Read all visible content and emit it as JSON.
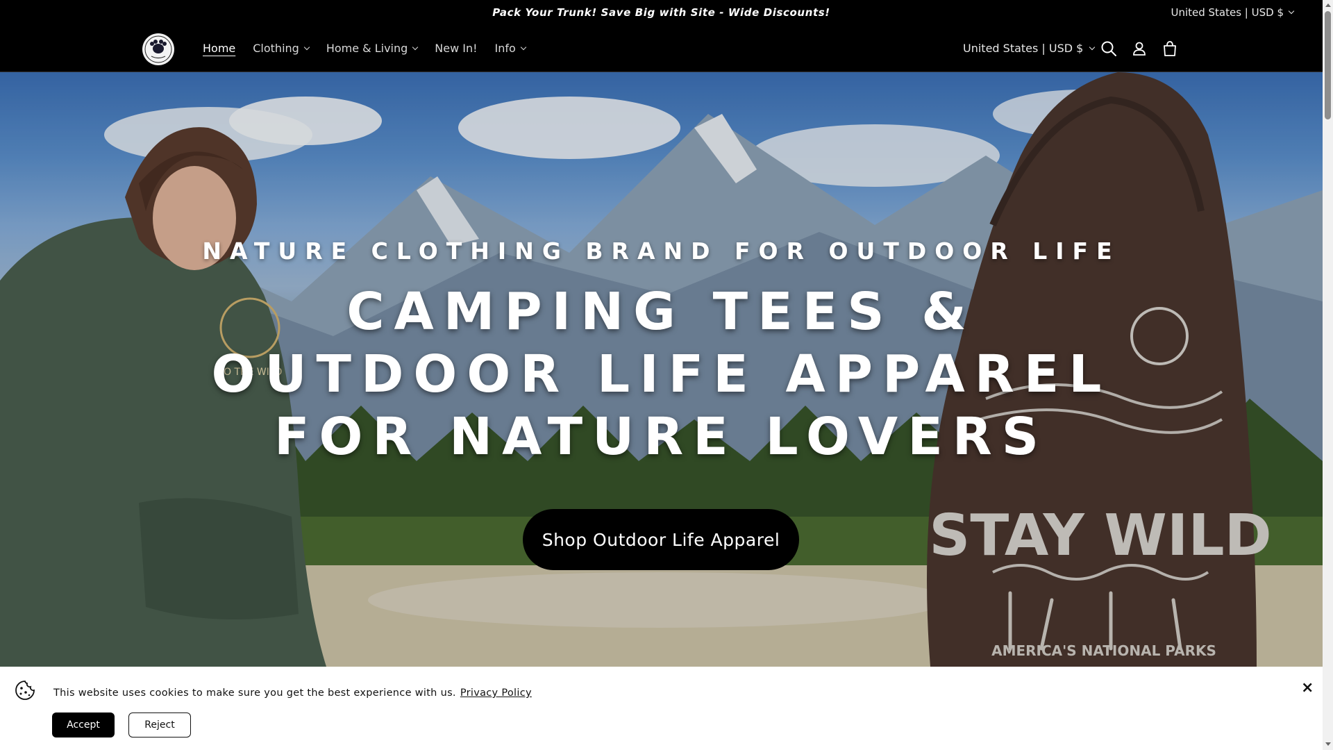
{
  "announcement": {
    "text": "Pack Your Trunk! Save Big with Site - Wide Discounts!",
    "locale": "United States | USD $"
  },
  "header": {
    "logo_text": "camping",
    "nav": [
      {
        "label": "Home",
        "active": true,
        "has_dropdown": false
      },
      {
        "label": "Clothing",
        "active": false,
        "has_dropdown": true
      },
      {
        "label": "Home & Living",
        "active": false,
        "has_dropdown": true
      },
      {
        "label": "New In!",
        "active": false,
        "has_dropdown": false
      },
      {
        "label": "Info",
        "active": false,
        "has_dropdown": true
      }
    ],
    "locale": "United States | USD $",
    "icons": [
      "search-icon",
      "account-icon",
      "cart-icon"
    ]
  },
  "hero": {
    "subtitle": "NATURE CLOTHING BRAND FOR OUTDOOR LIFE",
    "title": "CAMPING TEES & OUTDOOR LIFE APPAREL FOR NATURE LOVERS",
    "button": "Shop Outdoor Life Apparel",
    "hoodie_print_main": "STAY WILD",
    "hoodie_print_sub": "AMERICA'S NATIONAL PARKS",
    "left_hoodie_print": "TO THE WILD"
  },
  "cookie_banner": {
    "text": "This website uses cookies to make sure you get the best experience with us.",
    "link": "Privacy Policy",
    "accept": "Accept",
    "reject": "Reject",
    "close": "×"
  },
  "colors": {
    "bar_background": "#000000",
    "banner_background": "#ffffff",
    "button_primary": "#000000"
  }
}
